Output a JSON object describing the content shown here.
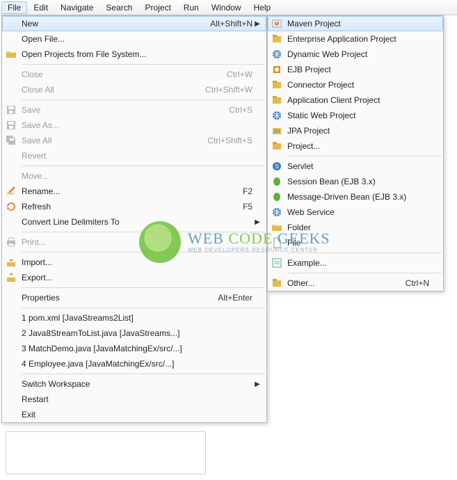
{
  "menubar": {
    "items": [
      "File",
      "Edit",
      "Navigate",
      "Search",
      "Project",
      "Run",
      "Window",
      "Help"
    ],
    "active": "File"
  },
  "file_menu": {
    "groups": [
      [
        {
          "label": "New",
          "accel": "Alt+Shift+N",
          "submenu": true,
          "highlight": true,
          "icon": ""
        },
        {
          "label": "Open File...",
          "icon": ""
        },
        {
          "label": "Open Projects from File System...",
          "icon": "folder-open"
        }
      ],
      [
        {
          "label": "Close",
          "accel": "Ctrl+W",
          "disabled": true
        },
        {
          "label": "Close All",
          "accel": "Ctrl+Shift+W",
          "disabled": true
        }
      ],
      [
        {
          "label": "Save",
          "accel": "Ctrl+S",
          "disabled": true,
          "icon": "save"
        },
        {
          "label": "Save As...",
          "disabled": true,
          "icon": "save"
        },
        {
          "label": "Save All",
          "accel": "Ctrl+Shift+S",
          "disabled": true,
          "icon": "save-all"
        },
        {
          "label": "Revert",
          "disabled": true
        }
      ],
      [
        {
          "label": "Move...",
          "disabled": true
        },
        {
          "label": "Rename...",
          "accel": "F2",
          "icon": "rename"
        },
        {
          "label": "Refresh",
          "accel": "F5",
          "icon": "refresh"
        },
        {
          "label": "Convert Line Delimiters To",
          "submenu": true
        }
      ],
      [
        {
          "label": "Print...",
          "disabled": true,
          "icon": "print"
        }
      ],
      [
        {
          "label": "Import...",
          "icon": "import"
        },
        {
          "label": "Export...",
          "icon": "export"
        }
      ],
      [
        {
          "label": "Properties",
          "accel": "Alt+Enter"
        }
      ],
      [
        {
          "label": "1 pom.xml  [JavaStreams2List]"
        },
        {
          "label": "2 Java8StreamToList.java  [JavaStreams...]"
        },
        {
          "label": "3 MatchDemo.java  [JavaMatchingEx/src/...]"
        },
        {
          "label": "4 Employee.java  [JavaMatchingEx/src/...]"
        }
      ],
      [
        {
          "label": "Switch Workspace",
          "submenu": true
        },
        {
          "label": "Restart"
        },
        {
          "label": "Exit"
        }
      ]
    ]
  },
  "new_menu": {
    "groups": [
      [
        {
          "label": "Maven Project",
          "icon": "maven",
          "highlight": true
        },
        {
          "label": "Enterprise Application Project",
          "icon": "project"
        },
        {
          "label": "Dynamic Web Project",
          "icon": "web-project"
        },
        {
          "label": "EJB Project",
          "icon": "ejb"
        },
        {
          "label": "Connector Project",
          "icon": "project"
        },
        {
          "label": "Application Client Project",
          "icon": "project"
        },
        {
          "label": "Static Web Project",
          "icon": "web-project"
        },
        {
          "label": "JPA Project",
          "icon": "jpa"
        },
        {
          "label": "Project...",
          "icon": "project-generic"
        }
      ],
      [
        {
          "label": "Servlet",
          "icon": "servlet"
        },
        {
          "label": "Session Bean (EJB 3.x)",
          "icon": "bean"
        },
        {
          "label": "Message-Driven Bean (EJB 3.x)",
          "icon": "bean"
        },
        {
          "label": "Web Service",
          "icon": "web-project"
        },
        {
          "label": "Folder",
          "icon": "folder"
        },
        {
          "label": "File",
          "icon": "file"
        }
      ],
      [
        {
          "label": "Example...",
          "icon": "example"
        }
      ],
      [
        {
          "label": "Other...",
          "accel": "Ctrl+N",
          "icon": "project-generic"
        }
      ]
    ]
  },
  "watermark": {
    "main_a": "WEB ",
    "main_b": "CODE ",
    "main_c": "GEEKS",
    "sub": "WEB DEVELOPERS RESOURCE CENTER"
  }
}
